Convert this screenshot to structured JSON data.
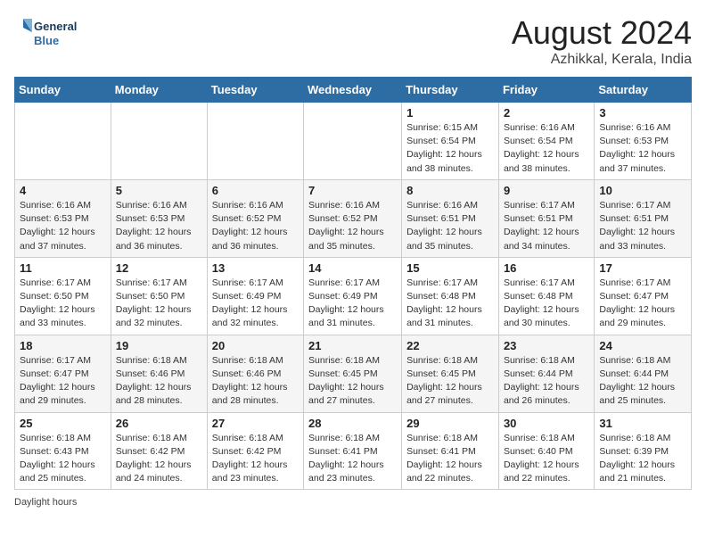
{
  "logo": {
    "line1": "General",
    "line2": "Blue"
  },
  "calendar": {
    "title": "August 2024",
    "subtitle": "Azhikkal, Kerala, India"
  },
  "days_of_week": [
    "Sunday",
    "Monday",
    "Tuesday",
    "Wednesday",
    "Thursday",
    "Friday",
    "Saturday"
  ],
  "weeks": [
    [
      {
        "day": "",
        "detail": ""
      },
      {
        "day": "",
        "detail": ""
      },
      {
        "day": "",
        "detail": ""
      },
      {
        "day": "",
        "detail": ""
      },
      {
        "day": "1",
        "detail": "Sunrise: 6:15 AM\nSunset: 6:54 PM\nDaylight: 12 hours\nand 38 minutes."
      },
      {
        "day": "2",
        "detail": "Sunrise: 6:16 AM\nSunset: 6:54 PM\nDaylight: 12 hours\nand 38 minutes."
      },
      {
        "day": "3",
        "detail": "Sunrise: 6:16 AM\nSunset: 6:53 PM\nDaylight: 12 hours\nand 37 minutes."
      }
    ],
    [
      {
        "day": "4",
        "detail": "Sunrise: 6:16 AM\nSunset: 6:53 PM\nDaylight: 12 hours\nand 37 minutes."
      },
      {
        "day": "5",
        "detail": "Sunrise: 6:16 AM\nSunset: 6:53 PM\nDaylight: 12 hours\nand 36 minutes."
      },
      {
        "day": "6",
        "detail": "Sunrise: 6:16 AM\nSunset: 6:52 PM\nDaylight: 12 hours\nand 36 minutes."
      },
      {
        "day": "7",
        "detail": "Sunrise: 6:16 AM\nSunset: 6:52 PM\nDaylight: 12 hours\nand 35 minutes."
      },
      {
        "day": "8",
        "detail": "Sunrise: 6:16 AM\nSunset: 6:51 PM\nDaylight: 12 hours\nand 35 minutes."
      },
      {
        "day": "9",
        "detail": "Sunrise: 6:17 AM\nSunset: 6:51 PM\nDaylight: 12 hours\nand 34 minutes."
      },
      {
        "day": "10",
        "detail": "Sunrise: 6:17 AM\nSunset: 6:51 PM\nDaylight: 12 hours\nand 33 minutes."
      }
    ],
    [
      {
        "day": "11",
        "detail": "Sunrise: 6:17 AM\nSunset: 6:50 PM\nDaylight: 12 hours\nand 33 minutes."
      },
      {
        "day": "12",
        "detail": "Sunrise: 6:17 AM\nSunset: 6:50 PM\nDaylight: 12 hours\nand 32 minutes."
      },
      {
        "day": "13",
        "detail": "Sunrise: 6:17 AM\nSunset: 6:49 PM\nDaylight: 12 hours\nand 32 minutes."
      },
      {
        "day": "14",
        "detail": "Sunrise: 6:17 AM\nSunset: 6:49 PM\nDaylight: 12 hours\nand 31 minutes."
      },
      {
        "day": "15",
        "detail": "Sunrise: 6:17 AM\nSunset: 6:48 PM\nDaylight: 12 hours\nand 31 minutes."
      },
      {
        "day": "16",
        "detail": "Sunrise: 6:17 AM\nSunset: 6:48 PM\nDaylight: 12 hours\nand 30 minutes."
      },
      {
        "day": "17",
        "detail": "Sunrise: 6:17 AM\nSunset: 6:47 PM\nDaylight: 12 hours\nand 29 minutes."
      }
    ],
    [
      {
        "day": "18",
        "detail": "Sunrise: 6:17 AM\nSunset: 6:47 PM\nDaylight: 12 hours\nand 29 minutes."
      },
      {
        "day": "19",
        "detail": "Sunrise: 6:18 AM\nSunset: 6:46 PM\nDaylight: 12 hours\nand 28 minutes."
      },
      {
        "day": "20",
        "detail": "Sunrise: 6:18 AM\nSunset: 6:46 PM\nDaylight: 12 hours\nand 28 minutes."
      },
      {
        "day": "21",
        "detail": "Sunrise: 6:18 AM\nSunset: 6:45 PM\nDaylight: 12 hours\nand 27 minutes."
      },
      {
        "day": "22",
        "detail": "Sunrise: 6:18 AM\nSunset: 6:45 PM\nDaylight: 12 hours\nand 27 minutes."
      },
      {
        "day": "23",
        "detail": "Sunrise: 6:18 AM\nSunset: 6:44 PM\nDaylight: 12 hours\nand 26 minutes."
      },
      {
        "day": "24",
        "detail": "Sunrise: 6:18 AM\nSunset: 6:44 PM\nDaylight: 12 hours\nand 25 minutes."
      }
    ],
    [
      {
        "day": "25",
        "detail": "Sunrise: 6:18 AM\nSunset: 6:43 PM\nDaylight: 12 hours\nand 25 minutes."
      },
      {
        "day": "26",
        "detail": "Sunrise: 6:18 AM\nSunset: 6:42 PM\nDaylight: 12 hours\nand 24 minutes."
      },
      {
        "day": "27",
        "detail": "Sunrise: 6:18 AM\nSunset: 6:42 PM\nDaylight: 12 hours\nand 23 minutes."
      },
      {
        "day": "28",
        "detail": "Sunrise: 6:18 AM\nSunset: 6:41 PM\nDaylight: 12 hours\nand 23 minutes."
      },
      {
        "day": "29",
        "detail": "Sunrise: 6:18 AM\nSunset: 6:41 PM\nDaylight: 12 hours\nand 22 minutes."
      },
      {
        "day": "30",
        "detail": "Sunrise: 6:18 AM\nSunset: 6:40 PM\nDaylight: 12 hours\nand 22 minutes."
      },
      {
        "day": "31",
        "detail": "Sunrise: 6:18 AM\nSunset: 6:39 PM\nDaylight: 12 hours\nand 21 minutes."
      }
    ]
  ],
  "footer": "Daylight hours"
}
